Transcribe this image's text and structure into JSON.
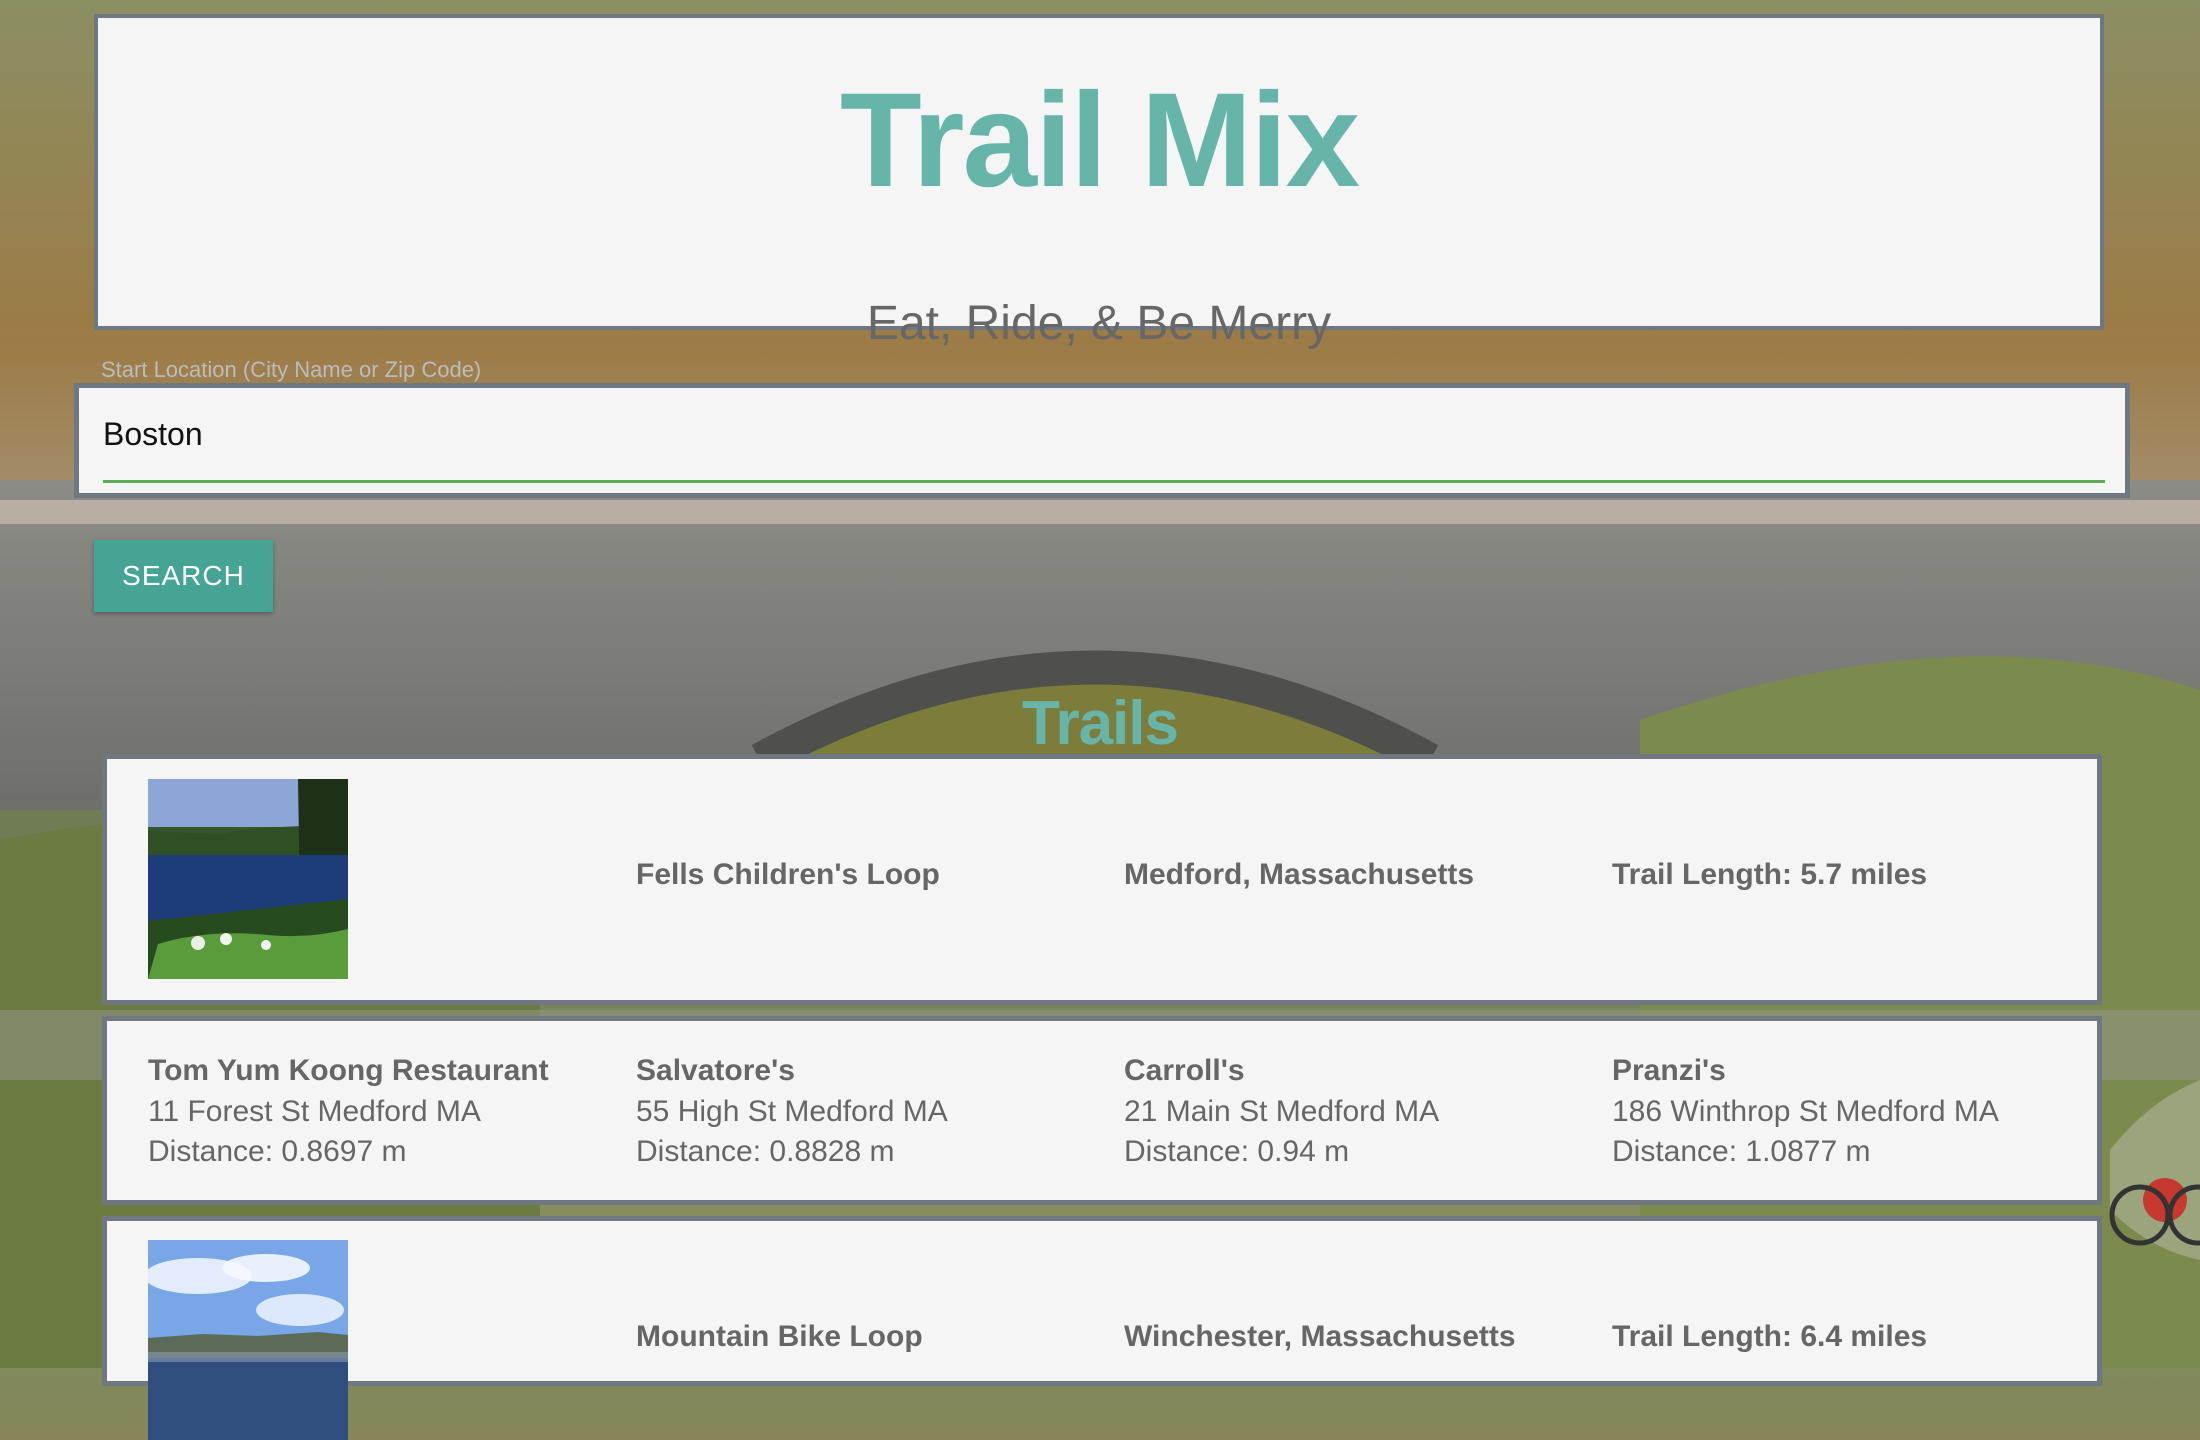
{
  "header": {
    "title": "Trail Mix",
    "subtitle": "Eat, Ride, & Be Merry"
  },
  "search": {
    "label": "Start Location (City Name or Zip Code)",
    "value": "Boston",
    "button_label": "SEARCH"
  },
  "trails_section": {
    "title": "Trails"
  },
  "trails": [
    {
      "name": "Fells Children's Loop",
      "location": "Medford, Massachusetts",
      "length_text": "Trail Length: 5.7 miles"
    },
    {
      "name": "Mountain Bike Loop",
      "location": "Winchester, Massachusetts",
      "length_text": "Trail Length: 6.4 miles"
    }
  ],
  "restaurants": [
    {
      "name": "Tom Yum Koong Restaurant",
      "address": "11 Forest St Medford MA",
      "distance": "Distance: 0.8697 m"
    },
    {
      "name": "Salvatore's",
      "address": "55 High St Medford MA",
      "distance": "Distance: 0.8828 m"
    },
    {
      "name": "Carroll's",
      "address": "21 Main St Medford MA",
      "distance": "Distance: 0.94 m"
    },
    {
      "name": "Pranzi's",
      "address": "186 Winthrop St Medford MA",
      "distance": "Distance: 1.0877 m"
    }
  ],
  "colors": {
    "accent": "#67b5a9",
    "button": "#45a493",
    "card": "#f5f5f5",
    "border": "#6f7880",
    "text": "#666666",
    "input_underline": "#5dae57"
  }
}
